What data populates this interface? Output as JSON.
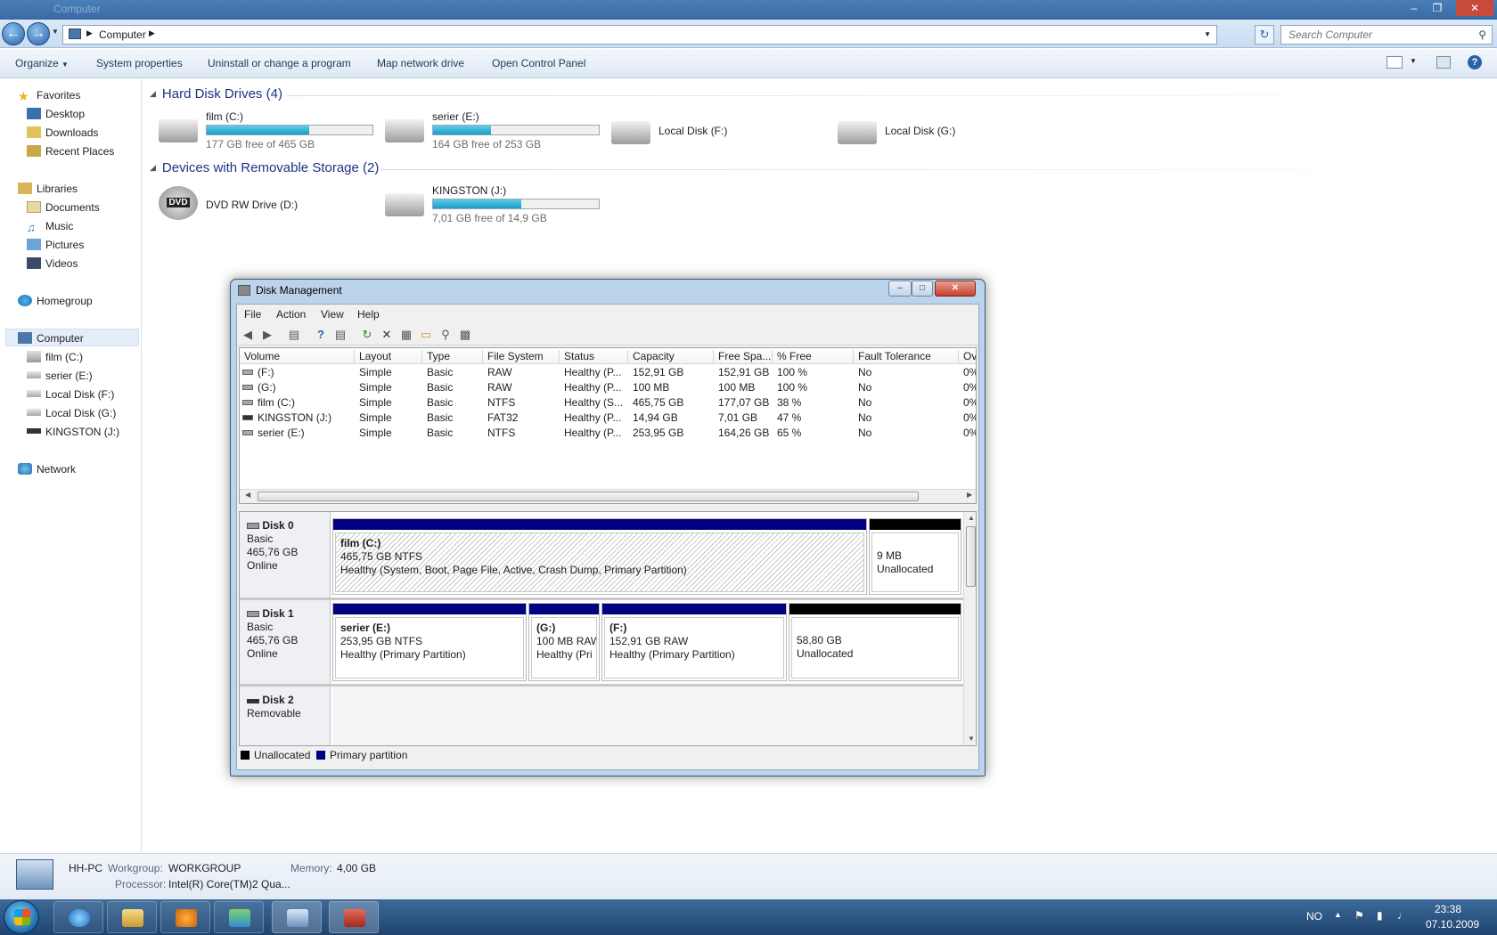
{
  "explorer": {
    "title": "Computer",
    "address_crumb": "Computer",
    "search_placeholder": "Search Computer",
    "commands": [
      "Organize",
      "System properties",
      "Uninstall or change a program",
      "Map network drive",
      "Open Control Panel"
    ],
    "nav": {
      "favorites": "Favorites",
      "desktop": "Desktop",
      "downloads": "Downloads",
      "recent": "Recent Places",
      "libraries": "Libraries",
      "documents": "Documents",
      "music": "Music",
      "pictures": "Pictures",
      "videos": "Videos",
      "homegroup": "Homegroup",
      "computer": "Computer",
      "film": "film (C:)",
      "serier": "serier (E:)",
      "diskf": "Local Disk (F:)",
      "diskg": "Local Disk (G:)",
      "kingston": "KINGSTON (J:)",
      "network": "Network"
    },
    "hdd_group": "Hard Disk Drives (4)",
    "removable_group": "Devices with Removable Storage (2)",
    "drives": [
      {
        "name": "film (C:)",
        "free": "177 GB free of 465 GB",
        "used_fraction": 0.62
      },
      {
        "name": "serier (E:)",
        "free": "164 GB free of 253 GB",
        "used_fraction": 0.35
      },
      {
        "name": "Local Disk (F:)"
      },
      {
        "name": "Local Disk (G:)"
      }
    ],
    "removable": [
      {
        "name": "DVD RW Drive (D:)",
        "icon_text": "DVD"
      },
      {
        "name": "KINGSTON (J:)",
        "free": "7,01 GB free of 14,9 GB",
        "used_fraction": 0.53
      }
    ],
    "details": {
      "pc_name": "HH-PC",
      "workgroup_label": "Workgroup:",
      "workgroup": "WORKGROUP",
      "memory_label": "Memory:",
      "memory": "4,00 GB",
      "processor_label": "Processor:",
      "processor": "Intel(R) Core(TM)2 Qua..."
    }
  },
  "taskbar": {
    "lang": "NO",
    "time": "23:38",
    "date": "07.10.2009"
  },
  "disk_mgmt": {
    "title": "Disk Management",
    "menu": [
      "File",
      "Action",
      "View",
      "Help"
    ],
    "columns": [
      "Volume",
      "Layout",
      "Type",
      "File System",
      "Status",
      "Capacity",
      "Free Spa...",
      "% Free",
      "Fault Tolerance",
      "Ov"
    ],
    "rows": [
      [
        "(F:)",
        "Simple",
        "Basic",
        "RAW",
        "Healthy (P...",
        "152,91 GB",
        "152,91 GB",
        "100 %",
        "No",
        "0%"
      ],
      [
        "(G:)",
        "Simple",
        "Basic",
        "RAW",
        "Healthy (P...",
        "100 MB",
        "100 MB",
        "100 %",
        "No",
        "0%"
      ],
      [
        "film (C:)",
        "Simple",
        "Basic",
        "NTFS",
        "Healthy (S...",
        "465,75 GB",
        "177,07 GB",
        "38 %",
        "No",
        "0%"
      ],
      [
        "KINGSTON (J:)",
        "Simple",
        "Basic",
        "FAT32",
        "Healthy (P...",
        "14,94 GB",
        "7,01 GB",
        "47 %",
        "No",
        "0%"
      ],
      [
        "serier (E:)",
        "Simple",
        "Basic",
        "NTFS",
        "Healthy (P...",
        "253,95 GB",
        "164,26 GB",
        "65 %",
        "No",
        "0%"
      ]
    ],
    "disks": [
      {
        "name": "Disk 0",
        "type": "Basic",
        "size": "465,76 GB",
        "state": "Online"
      },
      {
        "name": "Disk 1",
        "type": "Basic",
        "size": "465,76 GB",
        "state": "Online"
      },
      {
        "name": "Disk 2",
        "type": "Removable"
      }
    ],
    "partitions": {
      "c": {
        "l1": "film  (C:)",
        "l2": "465,75 GB NTFS",
        "l3": "Healthy (System, Boot, Page File, Active, Crash Dump, Primary Partition)"
      },
      "u0": {
        "l1": "9 MB",
        "l2": "Unallocated"
      },
      "e": {
        "l1": "serier  (E:)",
        "l2": "253,95 GB NTFS",
        "l3": "Healthy (Primary Partition)"
      },
      "g": {
        "l1": "(G:)",
        "l2": "100 MB RAW",
        "l3": "Healthy (Pri"
      },
      "f": {
        "l1": "(F:)",
        "l2": "152,91 GB RAW",
        "l3": "Healthy (Primary Partition)"
      },
      "u1": {
        "l1": "58,80 GB",
        "l2": "Unallocated"
      }
    },
    "legend_unallocated": "Unallocated",
    "legend_primary": "Primary partition",
    "colors": {
      "primary": "#000080",
      "unallocated": "#000000"
    }
  }
}
